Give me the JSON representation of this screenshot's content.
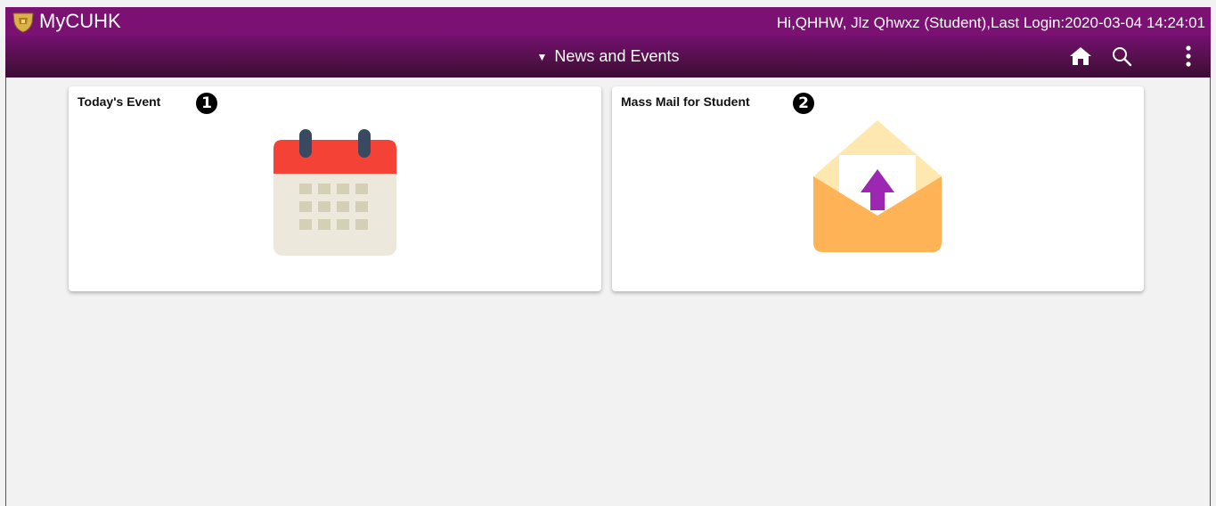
{
  "header": {
    "brand": "MyCUHK",
    "user_info": "Hi,QHHW, Jlz Qhwxz (Student),Last Login:2020-03-04 14:24:01"
  },
  "nav": {
    "caret": "▼",
    "title": "News and Events",
    "icons": [
      "home-icon",
      "search-icon",
      "more-options-icon"
    ]
  },
  "tiles": [
    {
      "title": "Today's Event",
      "badge": "1",
      "icon": "calendar-icon"
    },
    {
      "title": "Mass Mail for Student",
      "badge": "2",
      "icon": "envelope-upload-icon"
    }
  ],
  "colors": {
    "banner": "#7b1173",
    "nav_gradient_top": "#741070",
    "nav_gradient_bottom": "#3c0a35",
    "calendar_red": "#f44336",
    "envelope_orange": "#ffb357",
    "arrow_purple": "#9c27b0"
  }
}
